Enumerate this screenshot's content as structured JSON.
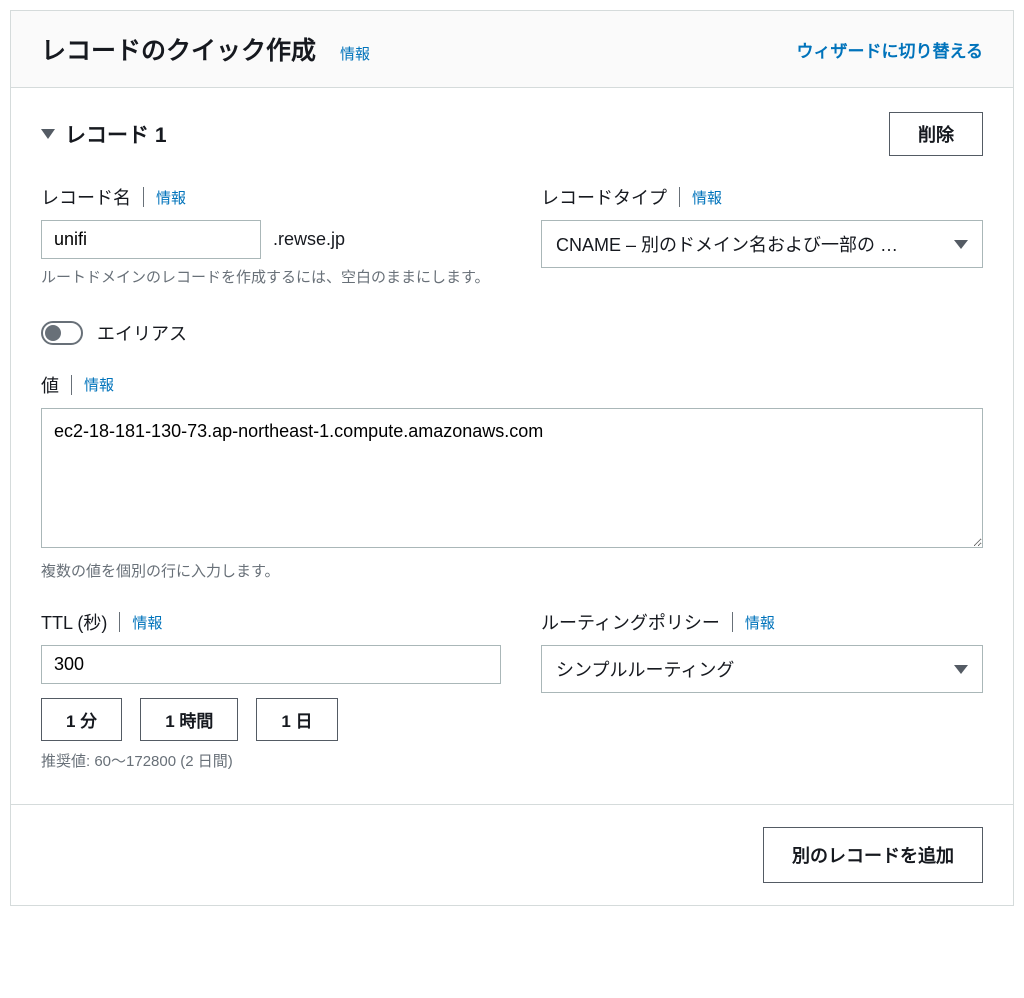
{
  "header": {
    "title": "レコードのクイック作成",
    "info": "情報",
    "switch_link": "ウィザードに切り替える"
  },
  "record": {
    "title": "レコード 1",
    "delete_label": "削除"
  },
  "record_name": {
    "label": "レコード名",
    "info": "情報",
    "value": "unifi",
    "suffix": ".rewse.jp",
    "help": "ルートドメインのレコードを作成するには、空白のままにします。"
  },
  "record_type": {
    "label": "レコードタイプ",
    "info": "情報",
    "selected": "CNAME – 別のドメイン名および一部の …"
  },
  "alias": {
    "label": "エイリアス"
  },
  "value": {
    "label": "値",
    "info": "情報",
    "content": "ec2-18-181-130-73.ap-northeast-1.compute.amazonaws.com",
    "help": "複数の値を個別の行に入力します。"
  },
  "ttl": {
    "label": "TTL (秒)",
    "info": "情報",
    "value": "300",
    "presets": [
      "1 分",
      "1 時間",
      "1 日"
    ],
    "help": "推奨値: 60〜172800 (2 日間)"
  },
  "routing": {
    "label": "ルーティングポリシー",
    "info": "情報",
    "selected": "シンプルルーティング"
  },
  "footer": {
    "add_label": "別のレコードを追加"
  }
}
